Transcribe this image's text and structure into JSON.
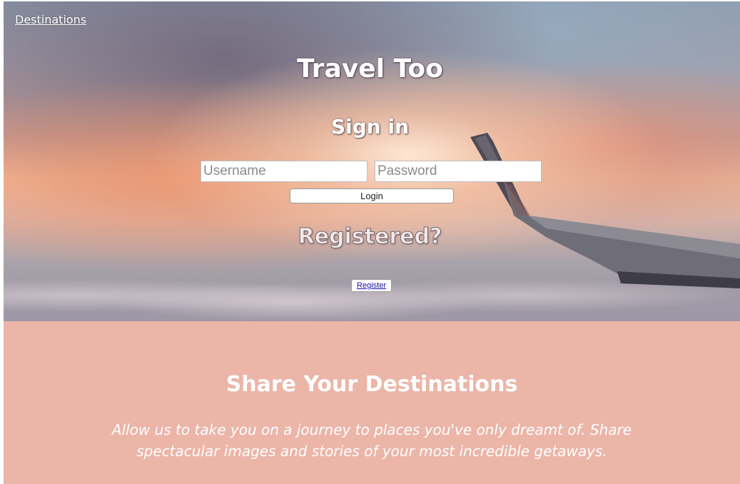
{
  "nav": {
    "destinations_link": "Destinations"
  },
  "hero": {
    "title": "Travel Too",
    "sign_in_heading": "Sign in",
    "username_placeholder": "Username",
    "password_placeholder": "Password",
    "login_label": "Login",
    "registered_heading": "Registered?",
    "register_label": "Register"
  },
  "share": {
    "title": "Share Your Destinations",
    "text": "Allow us to take you on a journey to places you've only dreamt of. Share spectacular images and stories of your most incredible getaways."
  },
  "colors": {
    "share_background": "#ebb5a8",
    "text_light": "#ffffff"
  }
}
